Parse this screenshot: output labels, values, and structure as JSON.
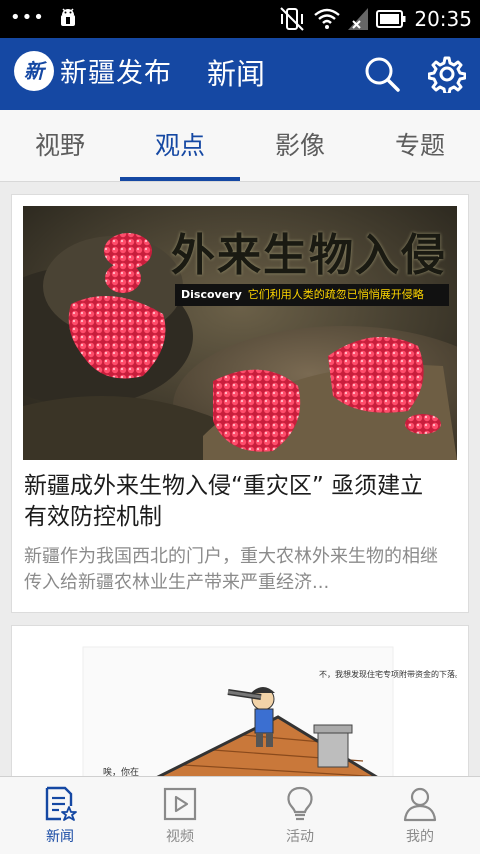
{
  "status_bar": {
    "time": "20:35",
    "left_icons": [
      "menu-dots-icon",
      "android-debug-icon"
    ],
    "right_icons": [
      "vibrate-off-icon",
      "wifi-icon",
      "no-signal-icon",
      "battery-icon"
    ]
  },
  "header": {
    "logo_text": "新",
    "brand": "新疆发布",
    "section": "新闻",
    "icons": [
      "search-icon",
      "settings-gear-icon"
    ],
    "color": "#1548a3"
  },
  "tabs": [
    {
      "label": "视野",
      "active": false
    },
    {
      "label": "观点",
      "active": true
    },
    {
      "label": "影像",
      "active": false
    },
    {
      "label": "专题",
      "active": false
    }
  ],
  "articles": [
    {
      "image_overlay_title": "外来生物入侵",
      "image_overlay_brand": "Discovery",
      "image_overlay_caption": "它们利用人类的疏忽已悄悄展开侵略",
      "title": "新疆成外来生物入侵“重灾区” 亟须建立有效防控机制",
      "summary": "新疆作为我国西北的门户，重大农林外来生物的相继传入给新疆农林业生产带来严重经济..."
    },
    {
      "image_caption_right": "不，我想发现住宅专项附带资金的下落。",
      "image_caption_left": "唉，你在"
    }
  ],
  "bottom_nav": [
    {
      "label": "新闻",
      "icon": "news-icon",
      "active": true
    },
    {
      "label": "视频",
      "icon": "video-icon",
      "active": false
    },
    {
      "label": "活动",
      "icon": "lightbulb-icon",
      "active": false
    },
    {
      "label": "我的",
      "icon": "user-icon",
      "active": false
    }
  ]
}
